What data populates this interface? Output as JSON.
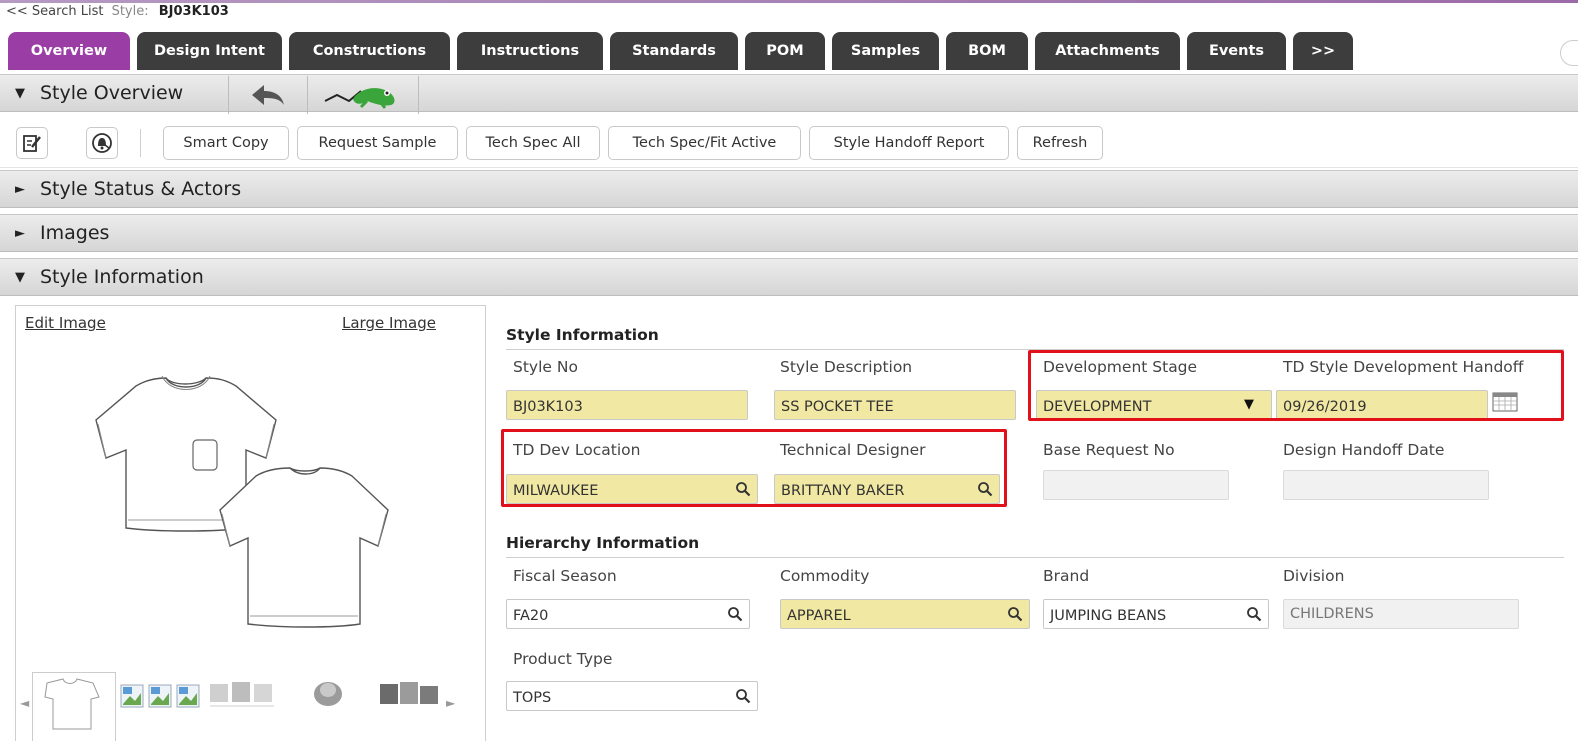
{
  "breadcrumb": {
    "back_link": "<< Search List",
    "style_label": "Style:",
    "style_value": "BJ03K103"
  },
  "tabs": [
    "Overview",
    "Design Intent",
    "Constructions",
    "Instructions",
    "Standards",
    "POM",
    "Samples",
    "BOM",
    "Attachments",
    "Events",
    ">>"
  ],
  "active_tab": "Overview",
  "sections": {
    "style_overview": "Style Overview",
    "style_status": "Style Status & Actors",
    "images": "Images",
    "style_information": "Style Information"
  },
  "toolbar": {
    "buttons": [
      "Smart Copy",
      "Request Sample",
      "Tech Spec All",
      "Tech Spec/Fit Active",
      "Style Handoff Report",
      "Refresh"
    ],
    "icons": [
      "edit-icon",
      "alert-bell-icon"
    ]
  },
  "overview_icons": [
    "back-arrow-icon",
    "frog-logo-icon"
  ],
  "image_panel": {
    "edit_image": "Edit Image",
    "large_image": "Large Image"
  },
  "style_info": {
    "group_title": "Style Information",
    "style_no": {
      "label": "Style No",
      "value": "BJ03K103"
    },
    "style_description": {
      "label": "Style Description",
      "value": "SS POCKET TEE"
    },
    "development_stage": {
      "label": "Development Stage",
      "value": "DEVELOPMENT"
    },
    "td_handoff": {
      "label": "TD Style Development Handoff",
      "value": "09/26/2019"
    },
    "td_dev_location": {
      "label": "TD Dev Location",
      "value": "MILWAUKEE"
    },
    "technical_designer": {
      "label": "Technical Designer",
      "value": "BRITTANY BAKER"
    },
    "base_request_no": {
      "label": "Base Request No",
      "value": ""
    },
    "design_handoff_date": {
      "label": "Design Handoff Date",
      "value": ""
    }
  },
  "hierarchy_info": {
    "group_title": "Hierarchy Information",
    "fiscal_season": {
      "label": "Fiscal Season",
      "value": "FA20"
    },
    "commodity": {
      "label": "Commodity",
      "value": "APPAREL"
    },
    "brand": {
      "label": "Brand",
      "value": "JUMPING BEANS"
    },
    "division": {
      "label": "Division",
      "value": "CHILDRENS"
    },
    "product_type": {
      "label": "Product Type",
      "value": "TOPS"
    }
  },
  "colors": {
    "active_tab": "#9a3ea6",
    "tab": "#3d3d3d",
    "required_field": "#f1e8a3",
    "highlight_box": "#e1101a",
    "frog_green": "#3aa53a"
  }
}
